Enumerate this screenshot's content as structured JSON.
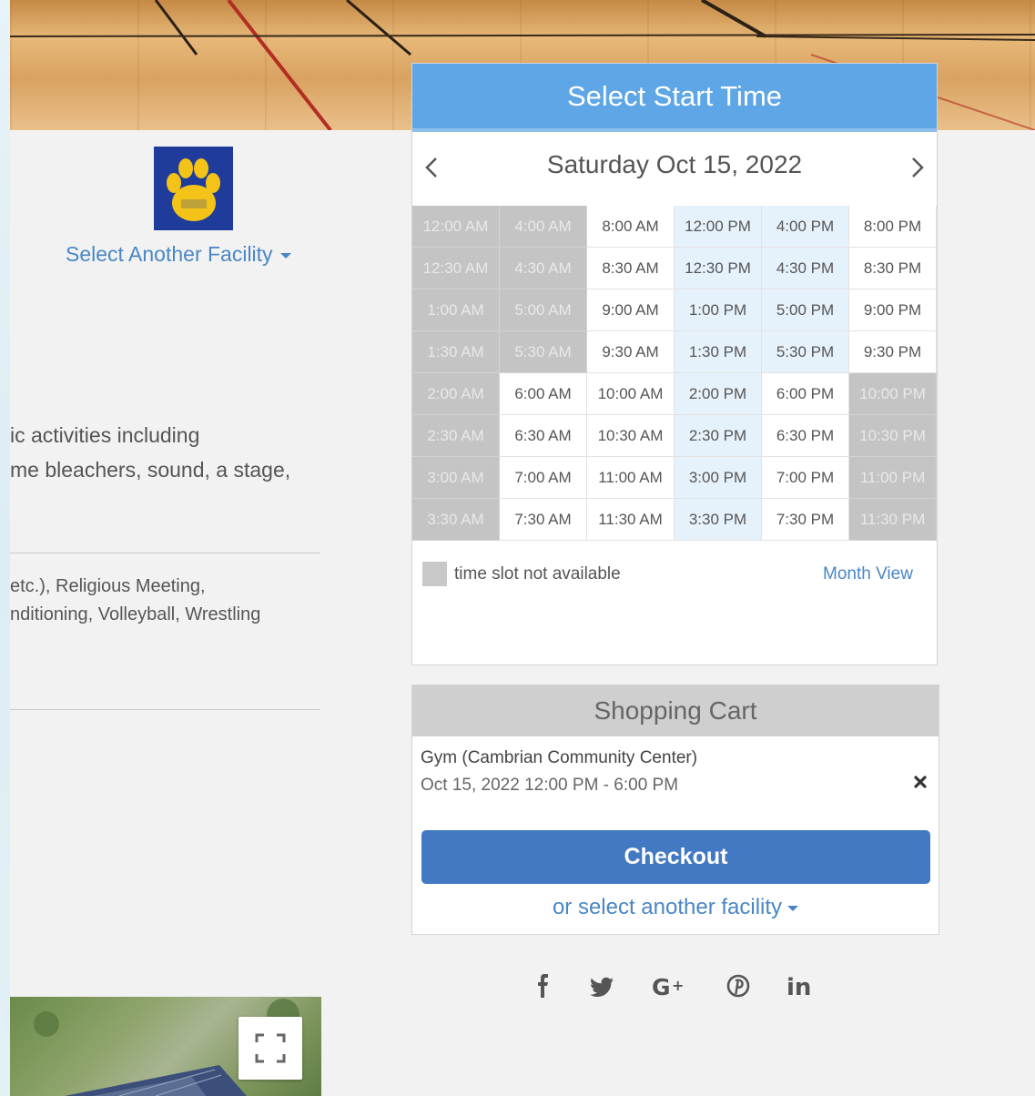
{
  "facility_picker": {
    "label": "Select Another Facility"
  },
  "description": {
    "line1": "ic activities including",
    "line2": "me bleachers, sound, a stage,"
  },
  "tags": {
    "line1": "etc.),    Religious Meeting,",
    "line2": "nditioning,    Volleyball,    Wrestling"
  },
  "scheduler": {
    "title": "Select Start Time",
    "date": "Saturday Oct 15, 2022",
    "prev_icon": "chevron-left-icon",
    "next_icon": "chevron-right-icon",
    "columns": [
      {
        "slots": [
          {
            "time": "12:00 AM",
            "status": "unavailable"
          },
          {
            "time": "12:30 AM",
            "status": "unavailable"
          },
          {
            "time": "1:00 AM",
            "status": "unavailable"
          },
          {
            "time": "1:30 AM",
            "status": "unavailable"
          },
          {
            "time": "2:00 AM",
            "status": "unavailable"
          },
          {
            "time": "2:30 AM",
            "status": "unavailable"
          },
          {
            "time": "3:00 AM",
            "status": "unavailable"
          },
          {
            "time": "3:30 AM",
            "status": "unavailable"
          }
        ]
      },
      {
        "slots": [
          {
            "time": "4:00 AM",
            "status": "unavailable"
          },
          {
            "time": "4:30 AM",
            "status": "unavailable"
          },
          {
            "time": "5:00 AM",
            "status": "unavailable"
          },
          {
            "time": "5:30 AM",
            "status": "unavailable"
          },
          {
            "time": "6:00 AM",
            "status": "available"
          },
          {
            "time": "6:30 AM",
            "status": "available"
          },
          {
            "time": "7:00 AM",
            "status": "available"
          },
          {
            "time": "7:30 AM",
            "status": "available"
          }
        ]
      },
      {
        "slots": [
          {
            "time": "8:00 AM",
            "status": "available"
          },
          {
            "time": "8:30 AM",
            "status": "available"
          },
          {
            "time": "9:00 AM",
            "status": "available"
          },
          {
            "time": "9:30 AM",
            "status": "available"
          },
          {
            "time": "10:00 AM",
            "status": "available"
          },
          {
            "time": "10:30 AM",
            "status": "available"
          },
          {
            "time": "11:00 AM",
            "status": "available"
          },
          {
            "time": "11:30 AM",
            "status": "available"
          }
        ]
      },
      {
        "slots": [
          {
            "time": "12:00 PM",
            "status": "selected"
          },
          {
            "time": "12:30 PM",
            "status": "selected"
          },
          {
            "time": "1:00 PM",
            "status": "selected"
          },
          {
            "time": "1:30 PM",
            "status": "selected"
          },
          {
            "time": "2:00 PM",
            "status": "selected"
          },
          {
            "time": "2:30 PM",
            "status": "selected"
          },
          {
            "time": "3:00 PM",
            "status": "selected"
          },
          {
            "time": "3:30 PM",
            "status": "selected"
          }
        ]
      },
      {
        "slots": [
          {
            "time": "4:00 PM",
            "status": "selected"
          },
          {
            "time": "4:30 PM",
            "status": "selected"
          },
          {
            "time": "5:00 PM",
            "status": "selected"
          },
          {
            "time": "5:30 PM",
            "status": "selected"
          },
          {
            "time": "6:00 PM",
            "status": "available"
          },
          {
            "time": "6:30 PM",
            "status": "available"
          },
          {
            "time": "7:00 PM",
            "status": "available"
          },
          {
            "time": "7:30 PM",
            "status": "available"
          }
        ]
      },
      {
        "slots": [
          {
            "time": "8:00 PM",
            "status": "available"
          },
          {
            "time": "8:30 PM",
            "status": "available"
          },
          {
            "time": "9:00 PM",
            "status": "available"
          },
          {
            "time": "9:30 PM",
            "status": "available"
          },
          {
            "time": "10:00 PM",
            "status": "unavailable"
          },
          {
            "time": "10:30 PM",
            "status": "unavailable"
          },
          {
            "time": "11:00 PM",
            "status": "unavailable"
          },
          {
            "time": "11:30 PM",
            "status": "unavailable"
          }
        ]
      }
    ],
    "legend_text": "time slot not available",
    "month_view_label": "Month View"
  },
  "cart": {
    "title": "Shopping Cart",
    "item_name": "Gym (Cambrian Community Center)",
    "item_time": "Oct 15, 2022 12:00 PM - 6:00 PM",
    "remove_icon": "close-icon",
    "checkout_label": "Checkout",
    "other_facility_label": "or select another facility"
  },
  "social": [
    "facebook-icon",
    "twitter-icon",
    "google-plus-icon",
    "pinterest-icon",
    "linkedin-icon"
  ],
  "colors": {
    "header_blue": "#5ea6e6",
    "link_blue": "#4a86c5",
    "checkout_blue": "#4279c2",
    "unavailable_gray": "#c4c4c4",
    "selected_tint": "#e6f2fb"
  }
}
